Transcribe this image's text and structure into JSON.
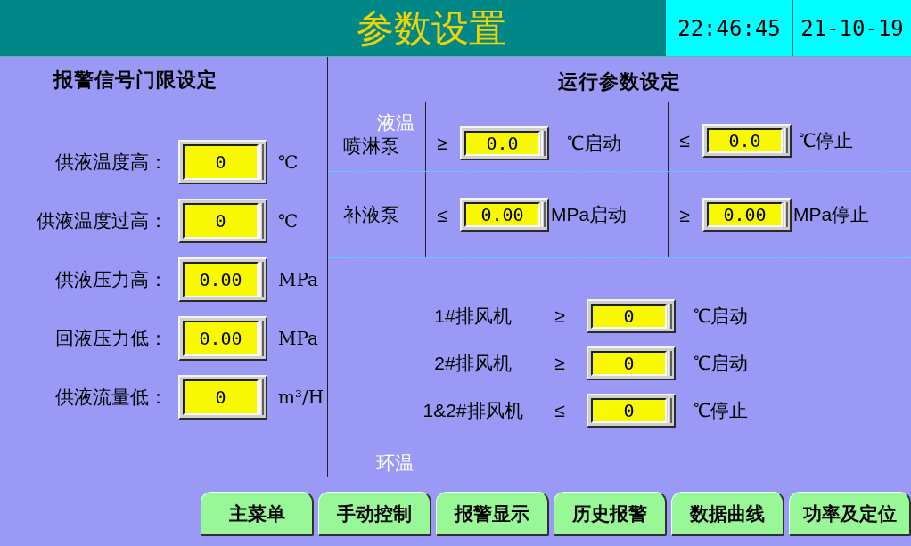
{
  "header": {
    "title": "参数设置",
    "time": "22:46:45",
    "date": "21-10-19"
  },
  "alarm_limits": {
    "heading": "报警信号门限设定",
    "rows": [
      {
        "label": "供液温度高：",
        "value": "0",
        "unit": "℃"
      },
      {
        "label": "供液温度过高：",
        "value": "0",
        "unit": "℃"
      },
      {
        "label": "供液压力高：",
        "value": "0.00",
        "unit": "MPa"
      },
      {
        "label": "回液压力低：",
        "value": "0.00",
        "unit": "MPa"
      },
      {
        "label": "供液流量低：",
        "value": "0",
        "unit": "m³/H"
      }
    ]
  },
  "run_params": {
    "heading": "运行参数设定",
    "liquid_temp_caption": "液温",
    "pumps": [
      {
        "name": "喷淋泵",
        "start": {
          "symbol": "≥",
          "value": "0.0",
          "unit": "℃启动"
        },
        "stop": {
          "symbol": "≤",
          "value": "0.0",
          "unit": "℃停止"
        }
      },
      {
        "name": "补液泵",
        "start": {
          "symbol": "≤",
          "value": "0.00",
          "unit": "MPa启动"
        },
        "stop": {
          "symbol": "≥",
          "value": "0.00",
          "unit": "MPa停止"
        }
      }
    ],
    "fans": [
      {
        "name": "1#排风机",
        "symbol": "≥",
        "value": "0",
        "unit": "℃启动"
      },
      {
        "name": "2#排风机",
        "symbol": "≥",
        "value": "0",
        "unit": "℃启动"
      },
      {
        "name": "1&2#排风机",
        "symbol": "≤",
        "value": "0",
        "unit": "℃停止"
      }
    ],
    "ambient_temp_caption": "环温"
  },
  "nav_buttons": [
    "主菜单",
    "手动控制",
    "报警显示",
    "历史报警",
    "数据曲线",
    "功率及定位"
  ]
}
